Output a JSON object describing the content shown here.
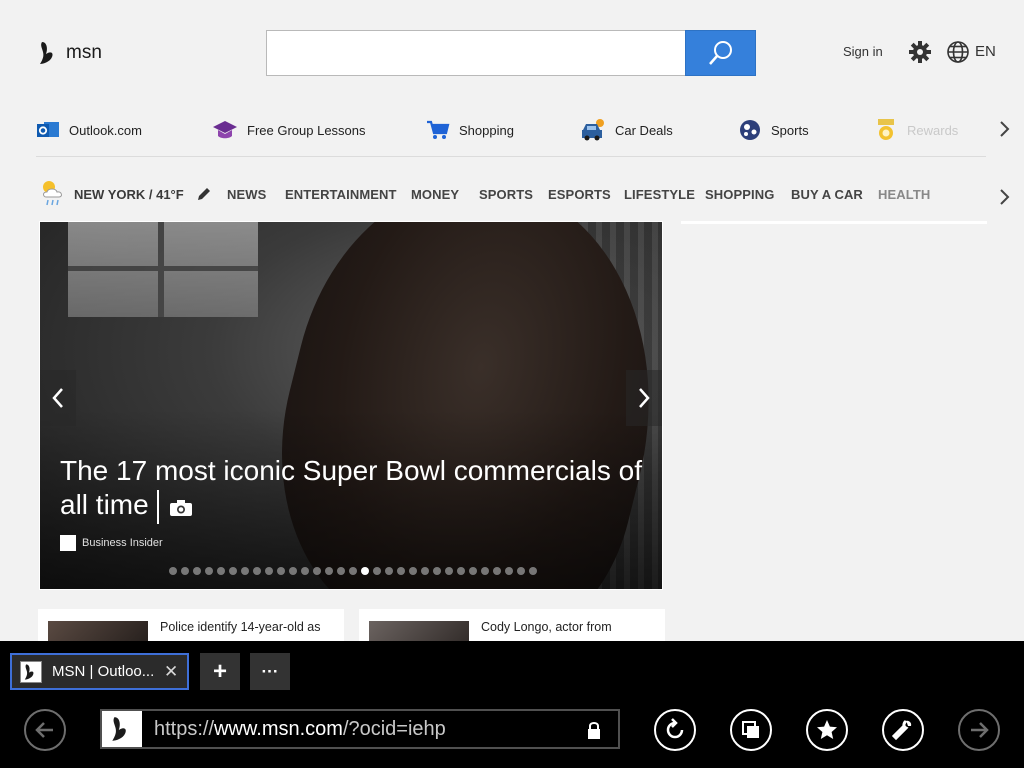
{
  "header": {
    "logo_text": "msn",
    "search_placeholder": "",
    "sign_in": "Sign in",
    "language": "EN"
  },
  "quick_links": [
    {
      "label": "Outlook.com",
      "icon": "outlook-icon"
    },
    {
      "label": "Free Group Lessons",
      "icon": "graduation-cap-icon"
    },
    {
      "label": "Shopping",
      "icon": "shopping-cart-icon"
    },
    {
      "label": "Car Deals",
      "icon": "car-icon"
    },
    {
      "label": "Sports",
      "icon": "sports-ball-icon"
    },
    {
      "label": "Rewards",
      "icon": "medal-icon"
    }
  ],
  "nav": {
    "weather": "NEW YORK / 41°F",
    "items": [
      "NEWS",
      "ENTERTAINMENT",
      "MONEY",
      "SPORTS",
      "ESPORTS",
      "LIFESTYLE",
      "SHOPPING",
      "BUY A CAR",
      "HEALTH"
    ]
  },
  "hero": {
    "title": "The 17 most iconic Super Bowl commercials of all time",
    "source": "Business Insider",
    "slide_count": 31,
    "active_slide": 16
  },
  "cards": [
    {
      "text": "Police identify 14-year-old as"
    },
    {
      "text": "Cody Longo, actor from"
    }
  ],
  "browser": {
    "tab_title": "MSN | Outloo...",
    "url_prefix": "https://",
    "url_host": "www.msn.com",
    "url_rest": "/?ocid=iehp"
  }
}
